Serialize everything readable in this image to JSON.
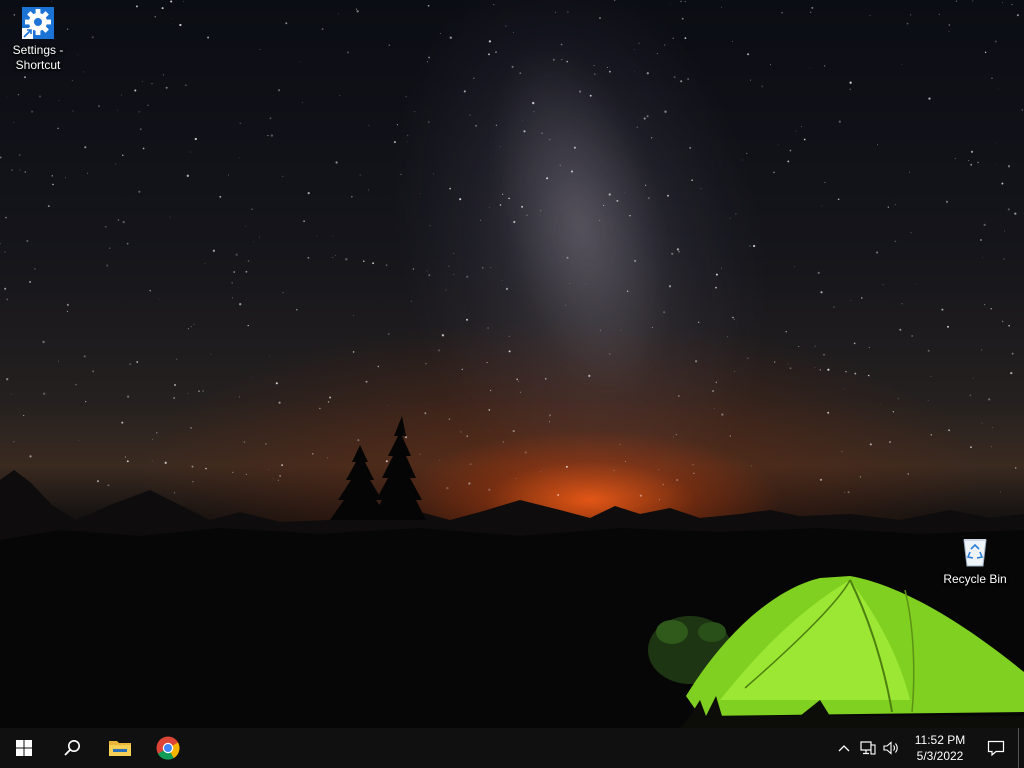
{
  "desktop": {
    "icons": [
      {
        "label": "Settings - Shortcut",
        "icon": "settings-gear-icon"
      },
      {
        "label": "Recycle Bin",
        "icon": "recycle-bin-icon"
      }
    ]
  },
  "taskbar": {
    "start_icon": "windows-logo-icon",
    "search_icon": "search-icon",
    "apps": [
      {
        "name": "File Explorer",
        "icon": "folder-icon"
      },
      {
        "name": "Google Chrome",
        "icon": "chrome-icon"
      }
    ],
    "tray": {
      "icons": [
        "chevron-up-icon",
        "network-icon",
        "volume-icon"
      ],
      "time": "11:52 PM",
      "date": "5/3/2022",
      "notification_icon": "action-center-icon"
    }
  },
  "colors": {
    "taskbar_bg": "#101010",
    "accent_blue": "#1c73d6",
    "tent_green": "#8fe02a",
    "horizon_orange": "#ff6a1a"
  }
}
